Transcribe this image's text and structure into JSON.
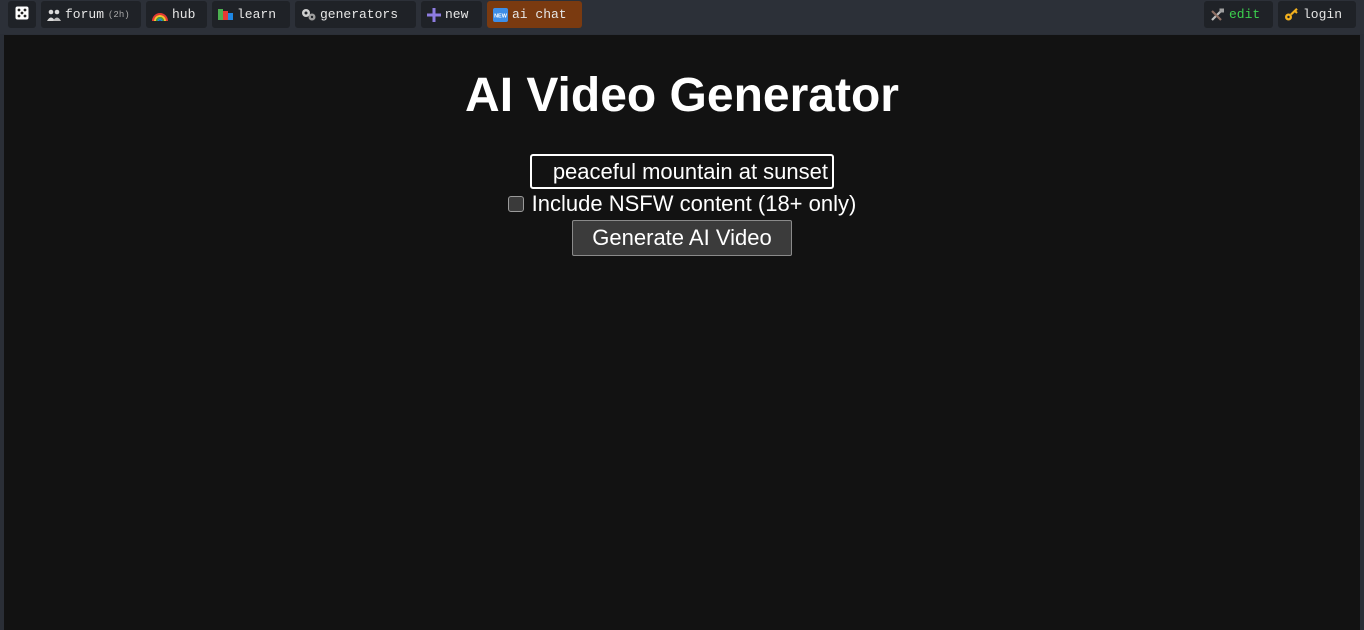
{
  "topbar": {
    "left": [
      {
        "name": "dice-button",
        "icon": "dice-icon",
        "label": ""
      },
      {
        "name": "forum-button",
        "icon": "people-icon",
        "label": "forum",
        "badge": "(2h)"
      },
      {
        "name": "hub-button",
        "icon": "rainbow-icon",
        "label": "hub"
      },
      {
        "name": "learn-button",
        "icon": "books-icon",
        "label": "learn"
      },
      {
        "name": "generators-button",
        "icon": "gears-icon",
        "label": "generators"
      },
      {
        "name": "new-button",
        "icon": "plus-icon",
        "label": "new"
      },
      {
        "name": "ai-chat-button",
        "icon": "new-badge-icon",
        "icon_text": "NEW",
        "label": "ai chat"
      }
    ],
    "right": [
      {
        "name": "edit-button",
        "icon": "tools-icon",
        "label": "edit"
      },
      {
        "name": "login-button",
        "icon": "key-icon",
        "label": "login"
      }
    ]
  },
  "main": {
    "title": "AI Video Generator",
    "prompt_value": "peaceful mountain at sunset",
    "nsfw_label": "Include NSFW content (18+ only)",
    "nsfw_checked": false,
    "generate_label": "Generate AI Video"
  },
  "colors": {
    "background": "#121212",
    "topbar": "#2c3038",
    "accent_button": "#7a3a10",
    "edit_text": "#3ccf4e"
  }
}
